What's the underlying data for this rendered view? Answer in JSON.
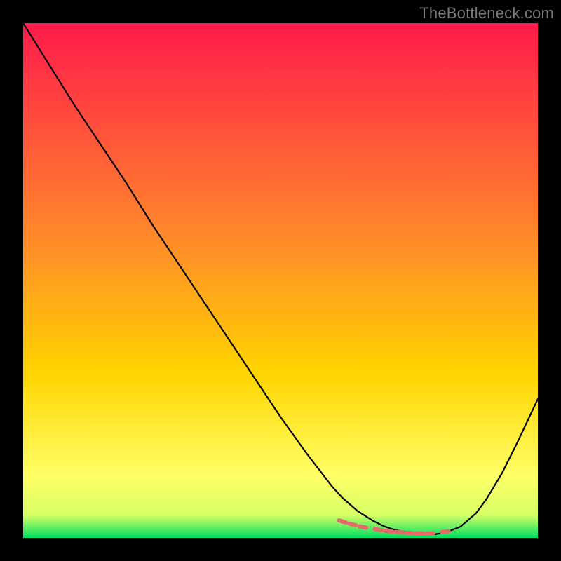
{
  "watermark": "TheBottleneck.com",
  "colors": {
    "gradient_top": "#ff1a4b",
    "gradient_mid": "#ffd400",
    "gradient_low": "#ffff66",
    "gradient_bottom": "#00e060",
    "curve": "#000000",
    "marker_fill": "#e66a6a",
    "marker_stroke": "#b94a4a"
  },
  "chart_data": {
    "type": "line",
    "title": "",
    "xlabel": "",
    "ylabel": "",
    "xlim": [
      0,
      100
    ],
    "ylim": [
      0,
      100
    ],
    "grid": false,
    "legend": false,
    "series": [
      {
        "name": "bottleneck-curve",
        "x": [
          0,
          5,
          10,
          15,
          20,
          25,
          30,
          35,
          40,
          45,
          50,
          55,
          60,
          62,
          65,
          68,
          70,
          72,
          75,
          78,
          80,
          82,
          85,
          88,
          90,
          93,
          96,
          100
        ],
        "y": [
          100,
          92,
          84,
          76.5,
          69,
          61,
          53.5,
          46,
          38.5,
          31,
          23.5,
          16.5,
          10,
          7.8,
          5.2,
          3.3,
          2.3,
          1.6,
          1.0,
          0.7,
          0.7,
          1.0,
          2.2,
          4.8,
          7.5,
          12.5,
          18.5,
          27
        ]
      }
    ],
    "markers": {
      "name": "highlight-band",
      "x": [
        62,
        64,
        66,
        69,
        71,
        73,
        75,
        77,
        79,
        82
      ],
      "y": [
        3.2,
        2.6,
        2.1,
        1.6,
        1.3,
        1.1,
        0.95,
        0.85,
        0.85,
        1.2
      ]
    }
  }
}
